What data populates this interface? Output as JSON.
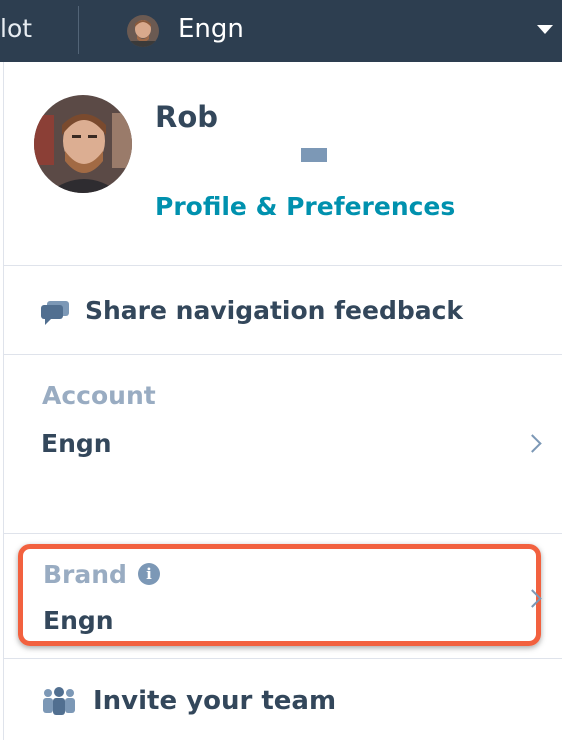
{
  "topbar": {
    "left_text": "lot",
    "account_name": "Engn"
  },
  "profile": {
    "name": "Rob",
    "link_label": "Profile & Preferences"
  },
  "feedback": {
    "label": "Share navigation feedback"
  },
  "account": {
    "title": "Account",
    "value": "Engn"
  },
  "brand": {
    "title": "Brand",
    "info_glyph": "i",
    "value": "Engn"
  },
  "invite": {
    "label": "Invite your team"
  },
  "colors": {
    "topbar_bg": "#2d3e50",
    "link": "#0091ae",
    "highlight": "#f2613f",
    "heading": "#33475b",
    "muted": "#99acc2"
  },
  "icons": {
    "chat": "chat-bubble-icon",
    "team": "team-icon",
    "info": "info-icon",
    "caret": "caret-down-icon",
    "chevron": "chevron-right-icon"
  }
}
